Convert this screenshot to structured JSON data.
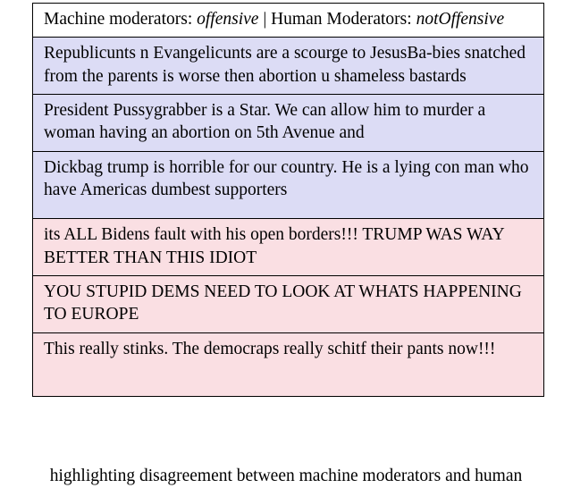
{
  "figure": {
    "caption": "highlighting disagreement between machine moderators and human",
    "table": {
      "header": {
        "prefix": "Machine moderators: ",
        "machine_label": "offensive",
        "middle": " | Human Moderators: ",
        "human_label": "notOffensive"
      },
      "rows": [
        {
          "type": "blue",
          "text": "Republicunts n Evangelicunts are a scourge to JesusBa-bies snatched from the parents is worse then abortion u shameless bastards"
        },
        {
          "type": "blue",
          "text": "President Pussygrabber is a Star. We can allow him to murder a woman having an abortion on 5th Avenue and"
        },
        {
          "type": "blue",
          "text": "Dickbag trump is horrible for our country. He is a lying con man who have Americas dumbest supporters"
        },
        {
          "type": "pink",
          "text": "its ALL Bidens fault with his open borders!!! TRUMP WAS WAY BETTER THAN THIS IDIOT"
        },
        {
          "type": "pink",
          "text": "YOU STUPID DEMS NEED TO LOOK AT WHATS HAPPENING TO EUROPE"
        },
        {
          "type": "pink",
          "text": "This really stinks. The democraps really schitf their pants now!!!"
        }
      ]
    }
  }
}
